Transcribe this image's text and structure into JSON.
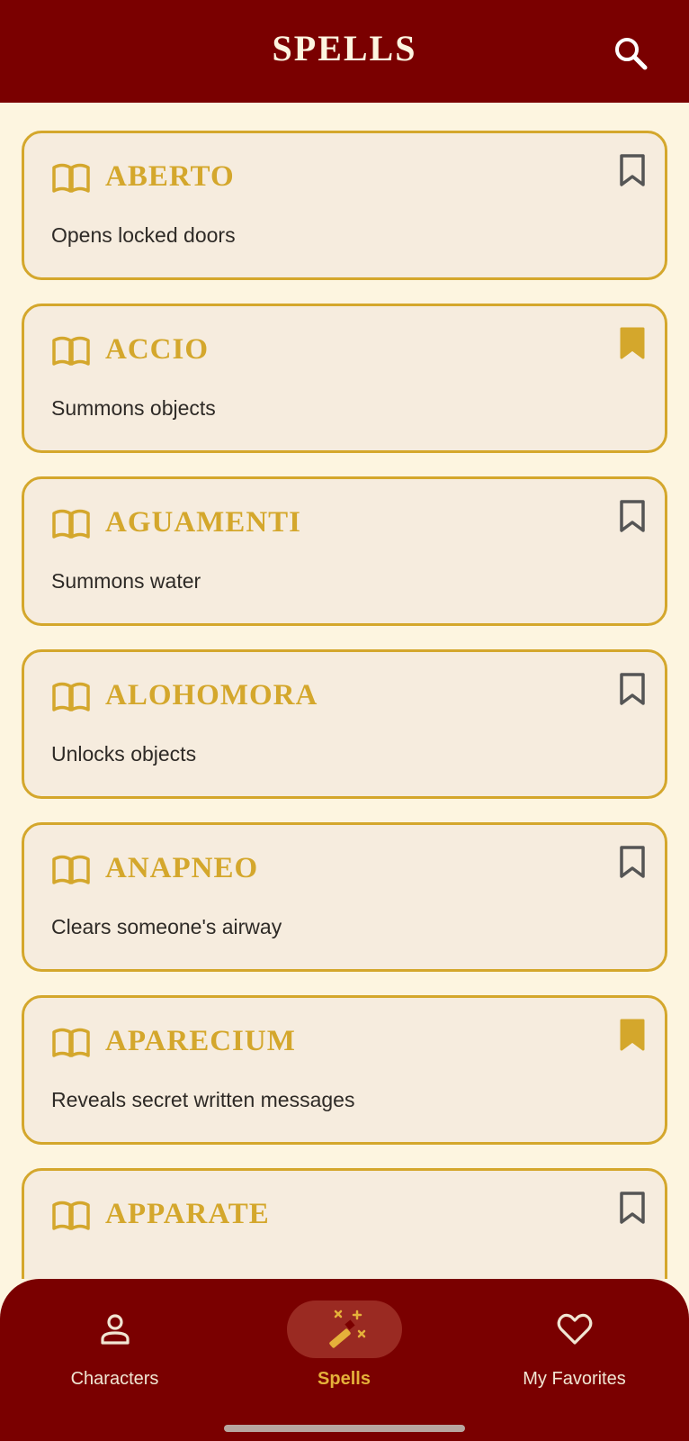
{
  "app_bar": {
    "title": "SPELLS",
    "search_icon": "search-icon"
  },
  "spells": [
    {
      "name": "ABERTO",
      "description": "Opens locked doors",
      "bookmarked": false
    },
    {
      "name": "ACCIO",
      "description": "Summons objects",
      "bookmarked": true
    },
    {
      "name": "AGUAMENTI",
      "description": "Summons water",
      "bookmarked": false
    },
    {
      "name": "ALOHOMORA",
      "description": "Unlocks objects",
      "bookmarked": false
    },
    {
      "name": "ANAPNEO",
      "description": "Clears someone's airway",
      "bookmarked": false
    },
    {
      "name": "APARECIUM",
      "description": "Reveals secret written messages",
      "bookmarked": true
    },
    {
      "name": "APPARATE",
      "description": "",
      "bookmarked": false
    }
  ],
  "bottom_nav": {
    "items": [
      {
        "label": "Characters",
        "icon": "person-icon",
        "active": false
      },
      {
        "label": "Spells",
        "icon": "magic-wand-icon",
        "active": true
      },
      {
        "label": "My Favorites",
        "icon": "heart-icon",
        "active": false
      }
    ]
  },
  "colors": {
    "primary": "#7a0000",
    "accent_gold": "#d4a72c",
    "background": "#fdf5e0",
    "card_background": "#f6ecde",
    "text_dark": "#2e2a26",
    "active_pill": "#9a2a22"
  }
}
